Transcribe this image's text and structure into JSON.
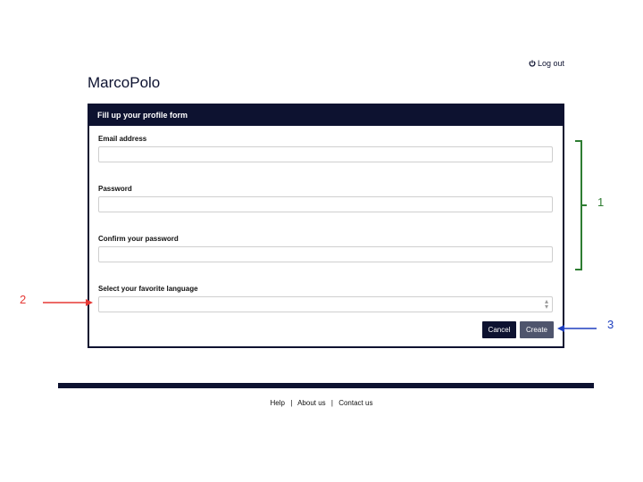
{
  "header": {
    "logout_label": "Log out",
    "brand": "MarcoPolo"
  },
  "form": {
    "title": "Fill up your profile form",
    "fields": [
      {
        "label": "Email address",
        "value": "",
        "placeholder": ""
      },
      {
        "label": "Password",
        "value": "",
        "placeholder": ""
      },
      {
        "label": "Confirm your password",
        "value": "",
        "placeholder": ""
      }
    ],
    "language": {
      "label": "Select your favorite language",
      "selected": ""
    },
    "cancel_label": "Cancel",
    "create_label": "Create"
  },
  "footer": {
    "links": [
      "Help",
      "About us",
      "Contact us"
    ],
    "separator": "|"
  },
  "annotations": {
    "one": "1",
    "two": "2",
    "three": "3",
    "colors": {
      "one": "#2e7d32",
      "two": "#e53935",
      "three": "#1e3fbf"
    }
  },
  "colors": {
    "primary": "#0d1230",
    "secondary_button": "#4f556d"
  }
}
